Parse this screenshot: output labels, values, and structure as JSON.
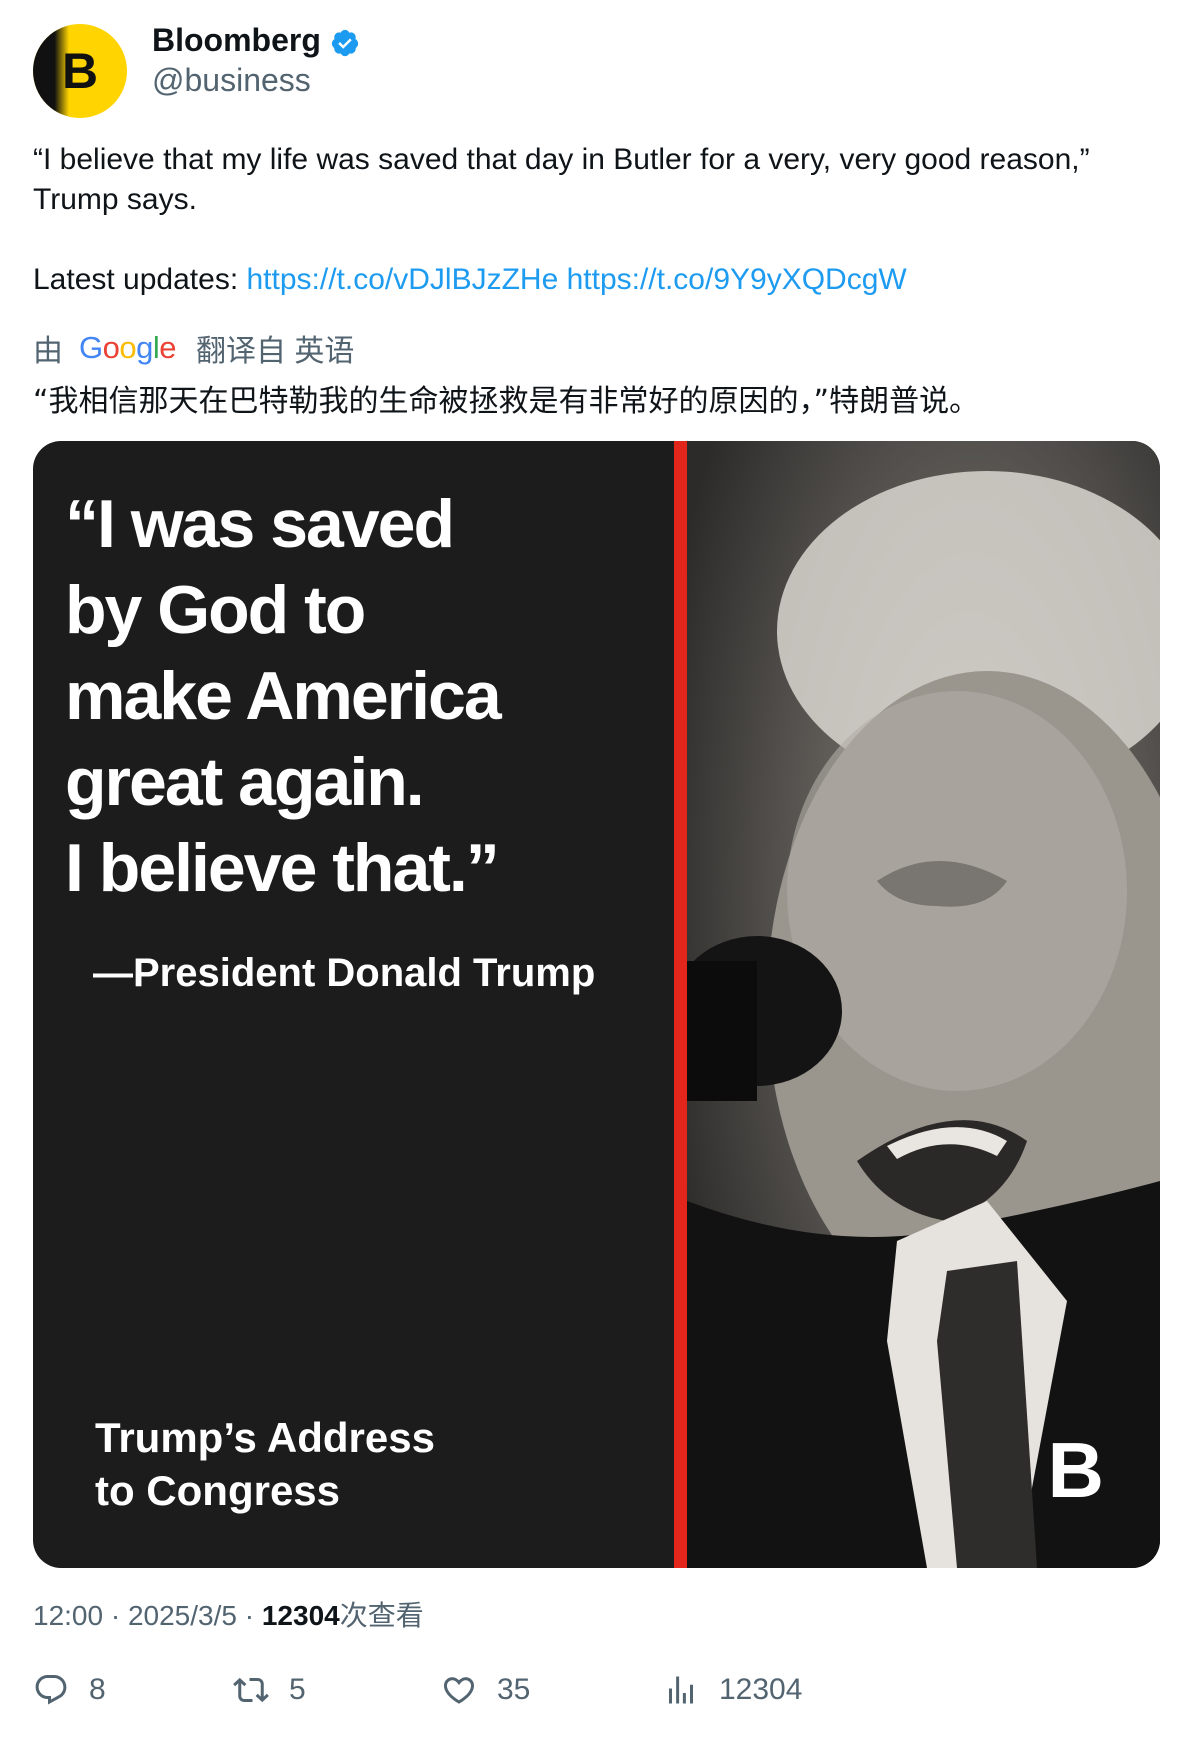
{
  "author": {
    "name": "Bloomberg",
    "handle": "@business",
    "avatar_letter": "B",
    "verified_icon": "verified-badge-icon"
  },
  "tweet": {
    "text": "“I believe that my life was saved that day in Butler for a very, very good reason,” Trump says.",
    "updates_label": "Latest updates:",
    "link1": "https://t.co/vDJlBJzZHe",
    "link2": "https://t.co/9Y9yXQDcgW"
  },
  "translation": {
    "prefix": "由",
    "provider": "Google",
    "suffix": "翻译自 英语",
    "text": "“我相信那天在巴特勒我的生命被拯救是有非常好的原因的，”特朗普说。"
  },
  "media": {
    "quote": "“I was saved\n by God to\n make America\n great again.\n I believe that.”",
    "attribution": "—President Donald Trump",
    "event": "Trump’s Address\nto Congress",
    "logo": "B"
  },
  "meta": {
    "time": "12:00",
    "date": "2025/3/5",
    "views": "12304",
    "views_label": "次查看"
  },
  "actions": {
    "replies": "8",
    "retweets": "5",
    "likes": "35",
    "views": "12304"
  },
  "colors": {
    "link": "#1d9bf0",
    "accent_red": "#e3261b",
    "brand_yellow": "#ffd400"
  }
}
